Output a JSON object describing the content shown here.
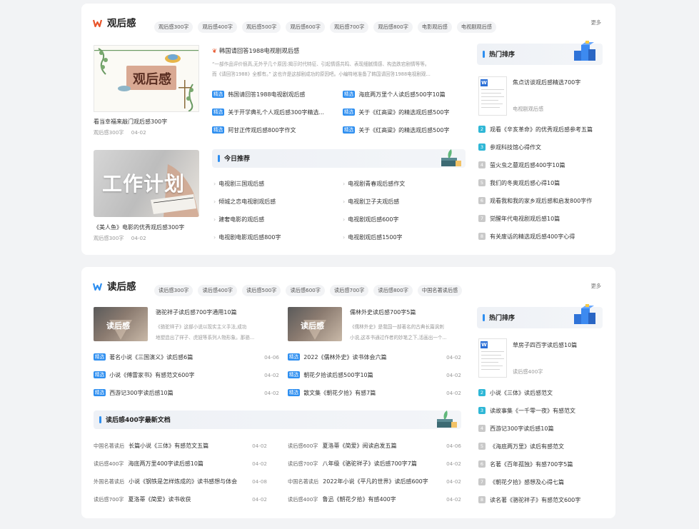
{
  "sec1": {
    "title": "观后感",
    "tags": [
      "观后感300字",
      "观后感400字",
      "观后感500字",
      "观后感600字",
      "观后感700字",
      "观后感800字",
      "电影观后感",
      "电视剧观后感"
    ],
    "more": "更多",
    "card1": {
      "img_text": "观后感",
      "title": "看当幸福来敲门观后感300字",
      "cat": "观后感300字",
      "date": "04-02"
    },
    "card2": {
      "img_text": "工作计划",
      "title": "《美人鱼》电影的优秀观后感300字",
      "cat": "观后感300字",
      "date": "04-02"
    },
    "feature": {
      "title": "韩国请回答1988电视剧观后感",
      "desc1": "“一部作品评价很高,无外乎几个原因:揭示时代特征、引起情感共鸣、表现细腻情感、构造跌宕剧情等等。",
      "desc2": "而《请回答1988》全都有。” 这也许是这部剧成功的原因吧。小编特地准备了韩国请回答1988电视剧观..."
    },
    "badge": "精选",
    "featured_list": [
      "韩国请回答1988电视剧观后感",
      "海底两万里个人读后感500字10篇",
      "关于开学典礼个人观后感300字精选...",
      "关于《红高粱》的精选观后感500字",
      "阿甘正传观后感800字作文",
      "关于《红高粱》的精选观后感500字"
    ],
    "today": {
      "title": "今日推荐",
      "items": [
        "电视剧三国观后感",
        "电视剧青春观后感作文",
        "倾城之恋电视剧观后感",
        "电视剧卫子夫观后感",
        "建奢电影的观后感",
        "电视剧观后感600字",
        "电视剧电影观后感800字",
        "电视剧观后感1500字"
      ]
    },
    "hot": {
      "title": "热门排序",
      "top_title": "焦点访谈观后感精选700字",
      "top_cat": "电视剧观后感",
      "items": [
        "观看《辛亥革命》的优秀观后感参考五篇",
        "参观科技馆心得作文",
        "萤火虫之墓观后感400字10篇",
        "我们的冬奥观后感心得10篇",
        "观看我和我的家乡观后感和启发800字作",
        "觉醒年代电视剧观后感10篇",
        "有关废话的精选观后感400字心得"
      ]
    }
  },
  "sec2": {
    "title": "读后感",
    "tags": [
      "读后感300字",
      "读后感400字",
      "读后感500字",
      "读后感600字",
      "读后感700字",
      "读后感800字",
      "中国名著读后感"
    ],
    "more": "更多",
    "art1": {
      "img_text": "读后感",
      "title": "骆驼祥子读后感700字通用10篇",
      "desc1": "《骆驼祥子》这部小说以现实主义手法,成功",
      "desc2": "地塑造出了祥子、虎妞等系列人物形象。那骆..."
    },
    "art2": {
      "img_text": "读后感",
      "title": "儒林外史读后感700字5篇",
      "desc1": "《儒林外史》是我国一部著名的古典长篇讽刺",
      "desc2": "小说,这本书通过作者的妙笔之下,活画出一个..."
    },
    "badge": "精选",
    "left_list": [
      {
        "text": "著名小说《三国演义》读后感6篇",
        "date": "04-06"
      },
      {
        "text": "小说《傅雷家书》有感范文600字",
        "date": "04-02"
      },
      {
        "text": "西游记300字读后感10篇",
        "date": "04-02"
      }
    ],
    "mid_list": [
      {
        "text": "2022《儒林外史》读书体会六篇",
        "date": "04-02"
      },
      {
        "text": "朝花夕拾读后感500字10篇",
        "date": "04-02"
      },
      {
        "text": "散文集《朝花夕拾》有感7篇",
        "date": "04-02"
      }
    ],
    "latest": {
      "title": "读后感400字最新文档",
      "left": [
        {
          "cat": "中国名著读后",
          "text": "长篇小说《三体》有感范文五篇",
          "date": "04-02"
        },
        {
          "cat": "读后感400字",
          "text": "海底两万里400字读后感10篇",
          "date": "04-02"
        },
        {
          "cat": "外国名著读后",
          "text": "小说《钢铁是怎样炼成的》读书感想与体会",
          "date": "04-08"
        },
        {
          "cat": "读后感700字",
          "text": "夏洛蒂《简爱》读书收获",
          "date": "04-02"
        }
      ],
      "right": [
        {
          "cat": "读后感600字",
          "text": "夏洛蒂《简爱》阅读启发五篇",
          "date": "04-06"
        },
        {
          "cat": "读后感700字",
          "text": "八年级《骆驼祥子》读后感700字7篇",
          "date": "04-02"
        },
        {
          "cat": "中国名著读后",
          "text": "2022年小说《平凡的世界》读后感600字",
          "date": "04-02"
        },
        {
          "cat": "读后感400字",
          "text": "鲁迅《朝花夕拾》有感400字",
          "date": "04-02"
        }
      ]
    },
    "hot": {
      "title": "热门排序",
      "top_title": "草房子四百字读后感10篇",
      "top_cat": "读后感400字",
      "items": [
        "小说《三体》读后感范文",
        "读故事集《一千零一夜》有感范文",
        "西游记300字读后感10篇",
        "《海底两万里》读后有感范文",
        "名著《百年孤独》有感700字5篇",
        "《朝花夕拾》感想及心得七篇",
        "读名著《骆驼祥子》有感范文600字"
      ]
    }
  }
}
